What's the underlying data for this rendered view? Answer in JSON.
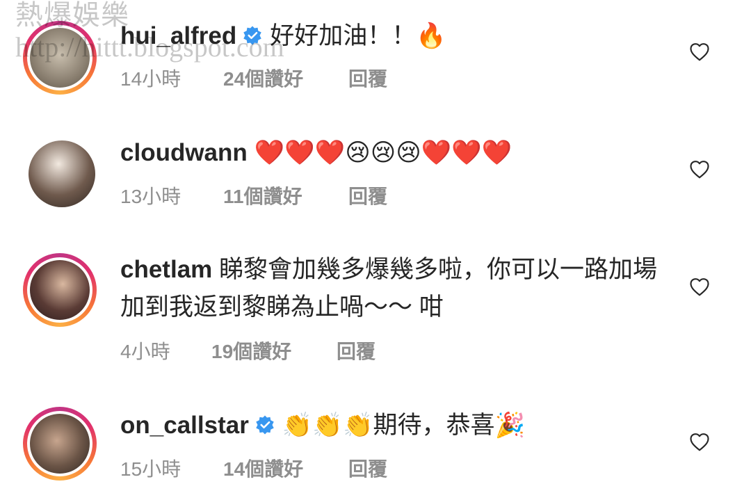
{
  "watermark": {
    "line1": "熱爆娛樂",
    "line2": "http://hittt.blogspot.com"
  },
  "comments": [
    {
      "username": "hui_alfred",
      "verified": true,
      "text": "好好加油！！🔥",
      "text_line2": "",
      "time": "14小時",
      "likes": "24個讚好",
      "reply": "回覆"
    },
    {
      "username": "cloudwann",
      "verified": false,
      "text": "❤️❤️❤️😢😢😢❤️❤️❤️",
      "text_line2": "",
      "time": "13小時",
      "likes": "11個讚好",
      "reply": "回覆"
    },
    {
      "username": "chetlam",
      "verified": false,
      "text": "睇黎會加幾多爆幾多啦，你可以一路加場",
      "text_line2": "加到我返到黎睇為止喎～～ 咁",
      "time": "4小時",
      "likes": "19個讚好",
      "reply": "回覆"
    },
    {
      "username": "on_callstar",
      "verified": true,
      "text": "👏👏👏期待，恭喜🎉",
      "text_line2": "",
      "time": "15小時",
      "likes": "14個讚好",
      "reply": "回覆"
    }
  ],
  "colors": {
    "verified": "#3897f0",
    "meta": "#8e8e8e",
    "text": "#262626"
  },
  "icons": {
    "like": "heart-outline-icon",
    "verified": "verified-badge-icon"
  }
}
